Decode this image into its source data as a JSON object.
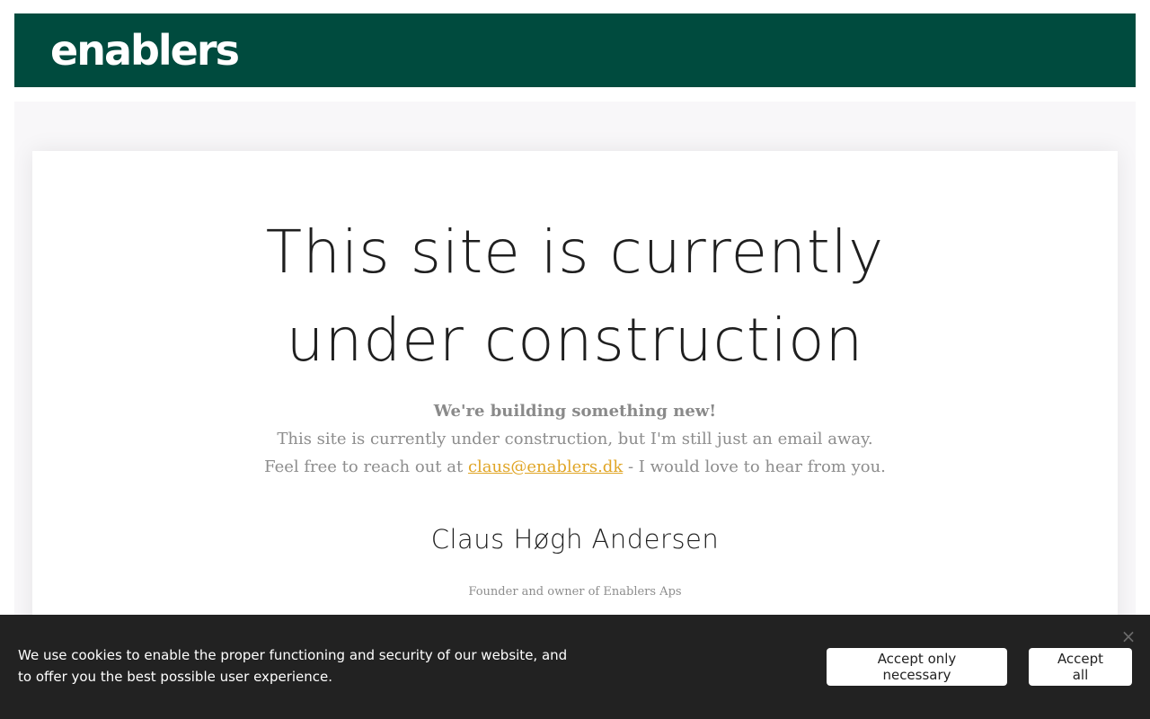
{
  "header": {
    "logo_text": "enablers",
    "background_color": "#004b3e"
  },
  "main": {
    "headline": "This site is currently under construction",
    "intro_strong": "We're building something new!",
    "intro_line2": "This site is currently under construction, but I'm still just an email away.",
    "intro_line3_before": "Feel free to reach out at",
    "email_link": "claus@enablers.dk",
    "intro_line3_after": "- I would love to hear from you.",
    "signature_name": "Claus Høgh Andersen",
    "signature_role": "Founder and owner of Enablers Aps",
    "link_color": "#e0a526"
  },
  "cookie_banner": {
    "text": "We use cookies to enable the proper functioning and security of our website, and to offer you the best possible user experience.",
    "accept_necessary_label": "Accept only necessary",
    "accept_all_label": "Accept all",
    "close_icon": "close-icon",
    "close_glyph": "×",
    "background_color": "#222222"
  }
}
